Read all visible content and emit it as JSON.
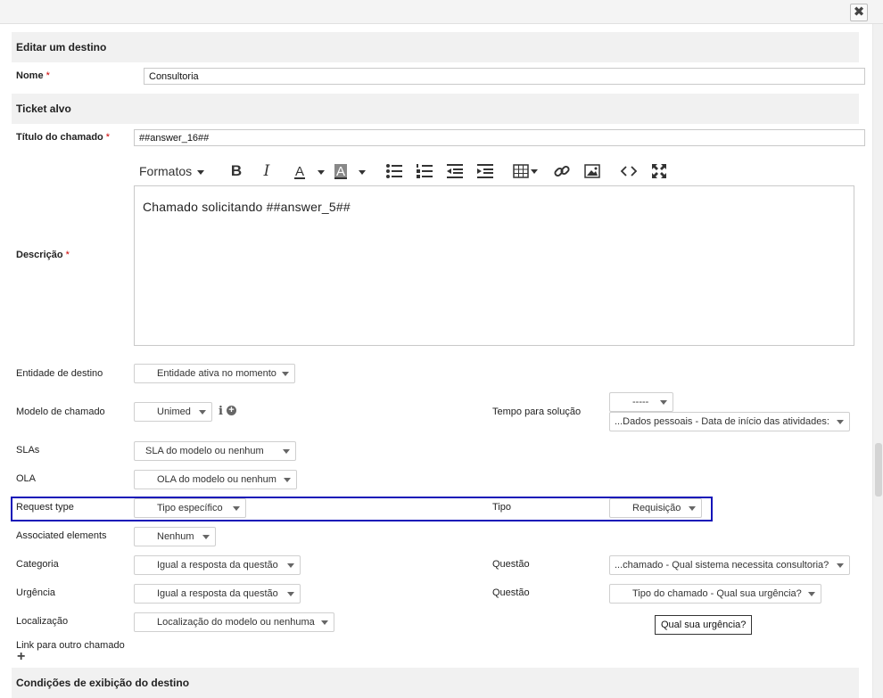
{
  "window": {
    "close_label": "✖"
  },
  "sections": {
    "edit_destination": "Editar um destino",
    "target_ticket": "Ticket alvo",
    "display_conditions": "Condições de exibição do destino"
  },
  "required_mark": "*",
  "form": {
    "name": {
      "label": "Nome",
      "value": "Consultoria"
    },
    "ticket_title": {
      "label": "Título do chamado",
      "value": "##answer_16##"
    },
    "description": {
      "label": "Descrição",
      "content": "Chamado solicitando ##answer_5##"
    },
    "entity": {
      "label": "Entidade de destino",
      "value": "Entidade ativa no momento"
    },
    "template": {
      "label": "Modelo de chamado",
      "value": "Unimed"
    },
    "solution_time": {
      "label": "Tempo para solução",
      "value_top": "-----",
      "value_bottom": "...Dados pessoais - Data de início das atividades:"
    },
    "slas": {
      "label": "SLAs",
      "value": "SLA do modelo ou nenhum"
    },
    "ola": {
      "label": "OLA",
      "value": "OLA do modelo ou nenhum"
    },
    "request_type": {
      "label": "Request type",
      "value": "Tipo específico"
    },
    "type": {
      "label": "Tipo",
      "value": "Requisição"
    },
    "associated": {
      "label": "Associated elements",
      "value": "Nenhum"
    },
    "category": {
      "label": "Categoria",
      "value": "Igual a resposta da questão"
    },
    "category_question": {
      "label": "Questão",
      "value": "...chamado - Qual sistema necessita consultoria?"
    },
    "urgency": {
      "label": "Urgência",
      "value": "Igual a resposta da questão"
    },
    "urgency_question": {
      "label": "Questão",
      "value": "Tipo do chamado - Qual sua urgência?"
    },
    "location": {
      "label": "Localização",
      "value": "Localização do modelo ou nenhuma"
    },
    "link": {
      "label": "Link para outro chamado",
      "add": "+"
    }
  },
  "editor_toolbar": {
    "formats_label": "Formatos",
    "icons": [
      "bold-icon",
      "italic-icon",
      "text-color-icon",
      "background-color-icon",
      "bullet-list-icon",
      "numbered-list-icon",
      "outdent-icon",
      "indent-icon",
      "table-icon",
      "link-icon",
      "image-icon",
      "source-code-icon",
      "fullscreen-icon"
    ]
  },
  "tooltip": "Qual sua urgência?",
  "colors": {
    "highlight_border": "#1414b8",
    "required": "#cc0000",
    "section_bg": "#f1f1f1"
  }
}
